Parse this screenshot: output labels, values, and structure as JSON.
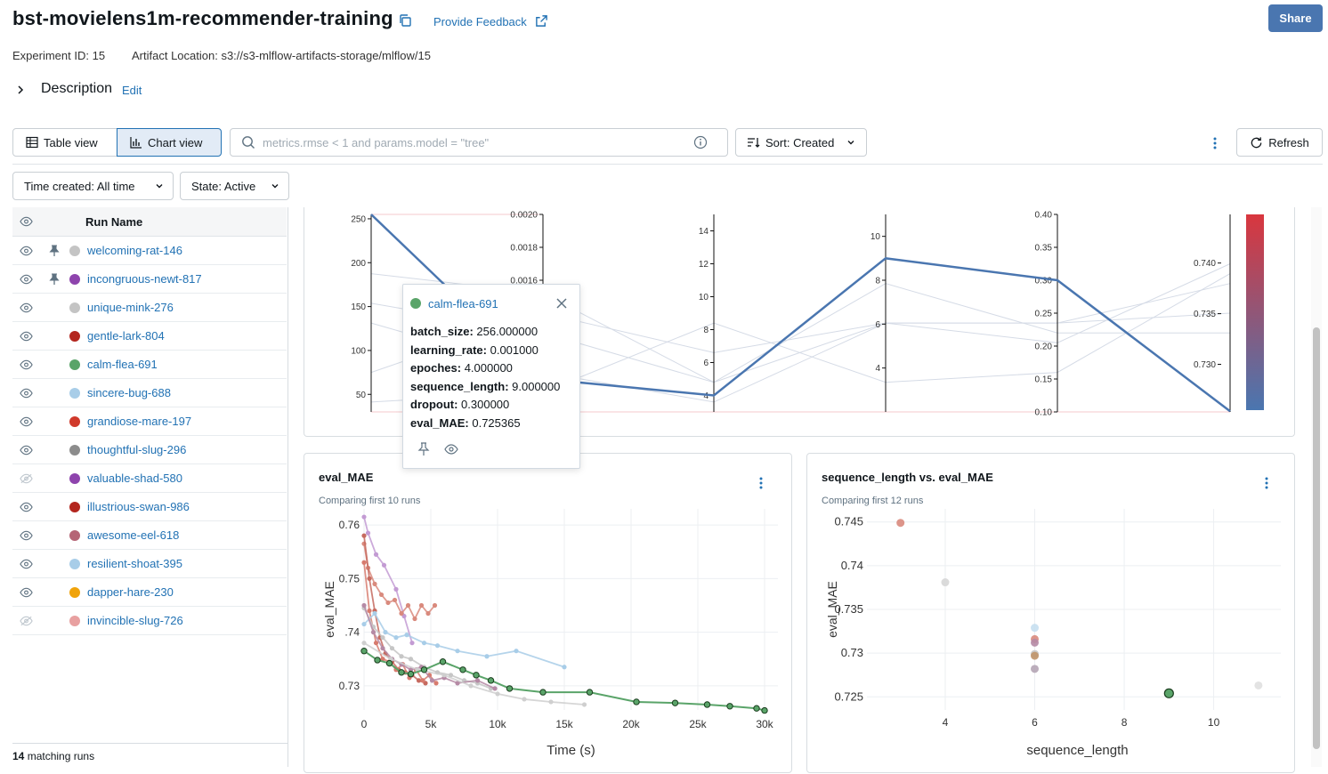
{
  "header": {
    "title": "bst-movielens1m-recommender-training",
    "feedback": "Provide Feedback",
    "share": "Share",
    "experiment_id": "Experiment ID: 15",
    "artifact_location": "Artifact Location: s3://s3-mlflow-artifacts-storage/mlflow/15",
    "description": "Description",
    "edit": "Edit"
  },
  "toolbar": {
    "table_view": "Table view",
    "chart_view": "Chart view",
    "search_placeholder": "metrics.rmse < 1 and params.model = \"tree\"",
    "sort": "Sort: Created",
    "refresh": "Refresh",
    "time_created": "Time created: All time",
    "state": "State: Active"
  },
  "runs": {
    "header": "Run Name",
    "footer_count": "14",
    "footer_text": " matching runs",
    "items": [
      {
        "name": "welcoming-rat-146",
        "color": "#c4c4c4",
        "pinned": true,
        "visible": true
      },
      {
        "name": "incongruous-newt-817",
        "color": "#8e44ad",
        "pinned": true,
        "visible": true
      },
      {
        "name": "unique-mink-276",
        "color": "#c4c4c4",
        "pinned": false,
        "visible": true
      },
      {
        "name": "gentle-lark-804",
        "color": "#b3261e",
        "pinned": false,
        "visible": true
      },
      {
        "name": "calm-flea-691",
        "color": "#5aa469",
        "pinned": false,
        "visible": true
      },
      {
        "name": "sincere-bug-688",
        "color": "#a8cde8",
        "pinned": false,
        "visible": true
      },
      {
        "name": "grandiose-mare-197",
        "color": "#d0392b",
        "pinned": false,
        "visible": true
      },
      {
        "name": "thoughtful-slug-296",
        "color": "#8c8c8c",
        "pinned": false,
        "visible": true
      },
      {
        "name": "valuable-shad-580",
        "color": "#8e44ad",
        "pinned": false,
        "visible": false
      },
      {
        "name": "illustrious-swan-986",
        "color": "#b3261e",
        "pinned": false,
        "visible": true
      },
      {
        "name": "awesome-eel-618",
        "color": "#b56576",
        "pinned": false,
        "visible": true
      },
      {
        "name": "resilient-shoat-395",
        "color": "#a8cde8",
        "pinned": false,
        "visible": true
      },
      {
        "name": "dapper-hare-230",
        "color": "#f0a30a",
        "pinned": false,
        "visible": true
      },
      {
        "name": "invincible-slug-726",
        "color": "#e8a0a0",
        "pinned": false,
        "visible": false
      }
    ]
  },
  "tooltip": {
    "run_name": "calm-flea-691",
    "color": "#5aa469",
    "params": [
      {
        "key": "batch_size:",
        "value": " 256.000000"
      },
      {
        "key": "learning_rate:",
        "value": " 0.001000"
      },
      {
        "key": "epoches:",
        "value": " 4.000000"
      },
      {
        "key": "sequence_length:",
        "value": " 9.000000"
      },
      {
        "key": "dropout:",
        "value": " 0.300000"
      },
      {
        "key": "eval_MAE:",
        "value": " 0.725365"
      }
    ]
  },
  "chart_data": [
    {
      "type": "parallel-coordinates",
      "axes": [
        {
          "ticks": [
            "250",
            "200",
            "150",
            "100",
            "50"
          ],
          "range": [
            30,
            255
          ]
        },
        {
          "ticks": [
            "0.0020",
            "0.0018",
            "0.0016"
          ],
          "range": [
            0.0008,
            0.002
          ]
        },
        {
          "ticks": [
            "14",
            "12",
            "10",
            "8",
            "6",
            "4"
          ],
          "range": [
            3,
            15
          ]
        },
        {
          "ticks": [
            "10",
            "8",
            "6",
            "4"
          ],
          "range": [
            2,
            11
          ]
        },
        {
          "ticks": [
            "0.40",
            "0.35",
            "0.30",
            "0.25",
            "0.20",
            "0.15",
            "0.10"
          ],
          "range": [
            0.1,
            0.4
          ]
        },
        {
          "ticks": [
            "0.740",
            "0.735",
            "0.730"
          ],
          "range": [
            0.7253,
            0.7448
          ]
        }
      ],
      "highlight": {
        "run": "calm-flea-691",
        "values": [
          256,
          0.001,
          4,
          9,
          0.3,
          0.725365
        ],
        "color": "#4a76b0"
      },
      "colorbar": {
        "top": "#d9363e",
        "bottom": "#4a76b0"
      }
    },
    {
      "type": "line",
      "title": "eval_MAE",
      "subtitle": "Comparing first 10 runs",
      "xlabel": "Time (s)",
      "ylabel": "eval_MAE",
      "xlim": [
        0,
        31000
      ],
      "ylim": [
        0.7255,
        0.763
      ],
      "xticks": [
        "0",
        "5k",
        "10k",
        "15k",
        "20k",
        "25k",
        "30k"
      ],
      "xtick_values": [
        0,
        5000,
        10000,
        15000,
        20000,
        25000,
        30000
      ],
      "yticks": [
        "0.73",
        ".74",
        "0.75",
        "0.76"
      ],
      "ytick_values": [
        0.73,
        0.74,
        0.75,
        0.76
      ],
      "series": [
        {
          "color": "#c39bd3",
          "x": [
            0,
            300,
            900,
            1500,
            2400,
            3000,
            3600
          ],
          "y": [
            0.7615,
            0.7585,
            0.7545,
            0.7525,
            0.748,
            0.743,
            0.738
          ]
        },
        {
          "color": "#d98a7d",
          "x": [
            0,
            300,
            800,
            1300,
            1800,
            2300,
            2800,
            3300,
            3800,
            4300,
            4800,
            5300
          ],
          "y": [
            0.7565,
            0.752,
            0.749,
            0.747,
            0.7455,
            0.746,
            0.7435,
            0.745,
            0.7425,
            0.745,
            0.7435,
            0.745
          ]
        },
        {
          "color": "#c66a5f",
          "x": [
            0,
            400,
            800,
            1200,
            1600,
            2100,
            2600,
            3100,
            3600,
            4100,
            4600
          ],
          "y": [
            0.758,
            0.75,
            0.744,
            0.739,
            0.736,
            0.7345,
            0.733,
            0.7325,
            0.732,
            0.731,
            0.7305
          ]
        },
        {
          "color": "#d77b6e",
          "x": [
            0,
            400,
            900,
            1400,
            1900,
            2400,
            2900,
            3400,
            3900,
            4400,
            4900,
            5400
          ],
          "y": [
            0.753,
            0.744,
            0.738,
            0.735,
            0.7345,
            0.733,
            0.734,
            0.7315,
            0.733,
            0.731,
            0.732,
            0.7305
          ]
        },
        {
          "color": "#c6c6c6",
          "x": [
            0,
            700,
            1400,
            2100,
            2800,
            3500,
            4500,
            5500,
            6500,
            7500,
            8500,
            9500
          ],
          "y": [
            0.7445,
            0.741,
            0.739,
            0.737,
            0.7355,
            0.735,
            0.7335,
            0.7325,
            0.732,
            0.731,
            0.7305,
            0.7295
          ]
        },
        {
          "color": "#a8cde8",
          "x": [
            0,
            800,
            1600,
            2400,
            3200,
            4500,
            5500,
            7000,
            9200,
            11400,
            15000
          ],
          "y": [
            0.7415,
            0.7435,
            0.74,
            0.739,
            0.7395,
            0.738,
            0.7375,
            0.7365,
            0.7355,
            0.7365,
            0.7335
          ]
        },
        {
          "color": "#b58aa5",
          "x": [
            0,
            700,
            1400,
            2100,
            2800,
            3500,
            4300,
            5100,
            6000,
            7000,
            8500,
            9800
          ],
          "y": [
            0.745,
            0.74,
            0.737,
            0.735,
            0.734,
            0.733,
            0.7335,
            0.731,
            0.7315,
            0.7305,
            0.731,
            0.7295
          ]
        },
        {
          "color": "#cfcfcf",
          "x": [
            0,
            2000,
            4000,
            6000,
            8000,
            10000,
            12000,
            14000,
            16500
          ],
          "y": [
            0.738,
            0.735,
            0.733,
            0.732,
            0.73,
            0.7285,
            0.7275,
            0.727,
            0.7265
          ]
        },
        {
          "color": "#5aa469",
          "highlight": true,
          "x": [
            0,
            1000,
            1900,
            2800,
            3500,
            4500,
            5900,
            7400,
            8400,
            9500,
            10900,
            13400,
            16900,
            20400,
            23300,
            25700,
            27400,
            29400,
            30000
          ],
          "y": [
            0.7365,
            0.7348,
            0.7342,
            0.7325,
            0.7322,
            0.733,
            0.7345,
            0.733,
            0.732,
            0.731,
            0.7295,
            0.7288,
            0.7288,
            0.727,
            0.7268,
            0.7265,
            0.7262,
            0.7258,
            0.7254
          ]
        }
      ]
    },
    {
      "type": "scatter",
      "title": "sequence_length vs. eval_MAE",
      "subtitle": "Comparing first 12 runs",
      "xlabel": "sequence_length",
      "ylabel": "eval_MAE",
      "xlim": [
        2.25,
        11.5
      ],
      "ylim": [
        0.7235,
        0.7465
      ],
      "xticks": [
        "4",
        "6",
        "8",
        "10"
      ],
      "xtick_values": [
        4,
        6,
        8,
        10
      ],
      "yticks": [
        "0.725",
        "0.73",
        "0.735",
        "0.74",
        "0.745"
      ],
      "ytick_values": [
        0.725,
        0.73,
        0.735,
        0.74,
        0.745
      ],
      "points": [
        {
          "x": 3,
          "y": 0.7449,
          "color": "#d98a7d"
        },
        {
          "x": 4,
          "y": 0.7381,
          "color": "#d6d6d6"
        },
        {
          "x": 6,
          "y": 0.7329,
          "color": "#c7dff0"
        },
        {
          "x": 6,
          "y": 0.7316,
          "color": "#d98a7d"
        },
        {
          "x": 6,
          "y": 0.7312,
          "color": "#b58aa5"
        },
        {
          "x": 6,
          "y": 0.7299,
          "color": "#c6c6c6"
        },
        {
          "x": 6,
          "y": 0.7297,
          "color": "#c0956a"
        },
        {
          "x": 6,
          "y": 0.7282,
          "color": "#b5a5b5"
        },
        {
          "x": 9,
          "y": 0.7254,
          "color": "#5aa469",
          "highlight": true
        },
        {
          "x": 11,
          "y": 0.7263,
          "color": "#e0e0e0"
        }
      ]
    }
  ]
}
